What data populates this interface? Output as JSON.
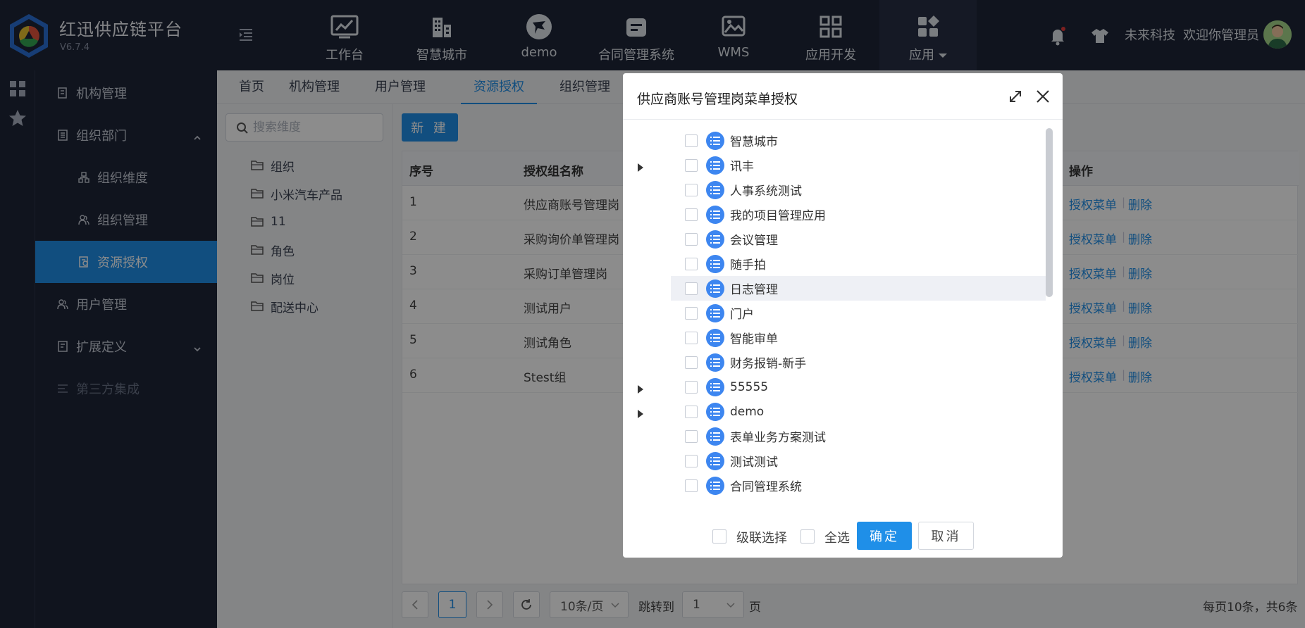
{
  "brand": {
    "title": "红迅供应链平台",
    "version": "V6.7.4"
  },
  "topnav": [
    {
      "label": "工作台",
      "icon": "chart-board-icon"
    },
    {
      "label": "智慧城市",
      "icon": "buildings-icon"
    },
    {
      "label": "demo",
      "icon": "bird-circle-icon"
    },
    {
      "label": "合同管理系统",
      "icon": "contract-box-icon"
    },
    {
      "label": "WMS",
      "icon": "picture-icon"
    },
    {
      "label": "应用开发",
      "icon": "grid-four-icon"
    },
    {
      "label": "应用",
      "icon": "apps-diamond-icon"
    }
  ],
  "header": {
    "company": "未来科技",
    "welcome": "欢迎你管理员"
  },
  "sidebar": {
    "items": [
      {
        "label": "机构管理",
        "icon": "org-icon"
      },
      {
        "label": "组织部门",
        "icon": "dept-icon"
      },
      {
        "label": "组织维度",
        "icon": "dimension-icon"
      },
      {
        "label": "组织管理",
        "icon": "people-icon"
      },
      {
        "label": "资源授权",
        "icon": "resource-icon"
      },
      {
        "label": "用户管理",
        "icon": "user-icon"
      },
      {
        "label": "扩展定义",
        "icon": "extend-icon"
      },
      {
        "label": "第三方集成",
        "icon": "integrate-icon"
      }
    ]
  },
  "tabs": [
    "首页",
    "机构管理",
    "用户管理",
    "资源授权",
    "组织管理"
  ],
  "search": {
    "placeholder": "搜索维度"
  },
  "org_tree": [
    "组织",
    "小米汽车产品",
    "11",
    "角色",
    "岗位",
    "配送中心"
  ],
  "toolbar": {
    "new_label": "新 建"
  },
  "table": {
    "headers": {
      "index": "序号",
      "name": "授权组名称",
      "ops": "操作"
    },
    "rows": [
      {
        "index": "1",
        "name": "供应商账号管理岗"
      },
      {
        "index": "2",
        "name": "采购询价单管理岗"
      },
      {
        "index": "3",
        "name": "采购订单管理岗"
      },
      {
        "index": "4",
        "name": "测试用户"
      },
      {
        "index": "5",
        "name": "测试角色"
      },
      {
        "index": "6",
        "name": "Stest组"
      }
    ],
    "action_auth": "授权菜单",
    "action_delete": "删除"
  },
  "pagination": {
    "current": "1",
    "page_size": "10条/页",
    "jump_label": "跳转到",
    "jump_value": "1",
    "page_unit": "页",
    "summary": "每页10条，共6条"
  },
  "modal": {
    "title": "供应商账号管理岗菜单授权",
    "nodes": [
      {
        "label": "智慧城市",
        "expandable": false
      },
      {
        "label": "讯丰",
        "expandable": true
      },
      {
        "label": "人事系统测试",
        "expandable": false
      },
      {
        "label": "我的项目管理应用",
        "expandable": false
      },
      {
        "label": "会议管理",
        "expandable": false
      },
      {
        "label": "随手拍",
        "expandable": false
      },
      {
        "label": "日志管理",
        "expandable": false
      },
      {
        "label": "门户",
        "expandable": false
      },
      {
        "label": "智能审单",
        "expandable": false
      },
      {
        "label": "财务报销-新手",
        "expandable": false
      },
      {
        "label": "55555",
        "expandable": true
      },
      {
        "label": "demo",
        "expandable": true
      },
      {
        "label": "表单业务方案测试",
        "expandable": false
      },
      {
        "label": "测试测试",
        "expandable": false
      },
      {
        "label": "合同管理系统",
        "expandable": false
      }
    ],
    "cascade_label": "级联选择",
    "select_all_label": "全选",
    "ok_label": "确定",
    "cancel_label": "取消"
  }
}
